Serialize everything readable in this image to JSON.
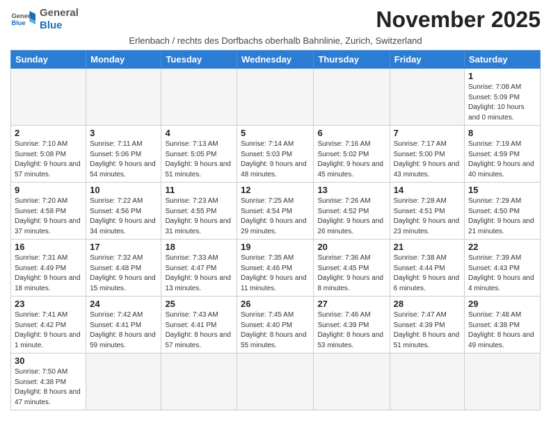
{
  "header": {
    "logo_general": "General",
    "logo_blue": "Blue",
    "month_title": "November 2025",
    "subtitle": "Erlenbach / rechts des Dorfbachs oberhalb Bahnlinie, Zurich, Switzerland"
  },
  "weekdays": [
    "Sunday",
    "Monday",
    "Tuesday",
    "Wednesday",
    "Thursday",
    "Friday",
    "Saturday"
  ],
  "weeks": [
    [
      {
        "day": "",
        "info": ""
      },
      {
        "day": "",
        "info": ""
      },
      {
        "day": "",
        "info": ""
      },
      {
        "day": "",
        "info": ""
      },
      {
        "day": "",
        "info": ""
      },
      {
        "day": "",
        "info": ""
      },
      {
        "day": "1",
        "info": "Sunrise: 7:08 AM\nSunset: 5:09 PM\nDaylight: 10 hours\nand 0 minutes."
      }
    ],
    [
      {
        "day": "2",
        "info": "Sunrise: 7:10 AM\nSunset: 5:08 PM\nDaylight: 9 hours\nand 57 minutes."
      },
      {
        "day": "3",
        "info": "Sunrise: 7:11 AM\nSunset: 5:06 PM\nDaylight: 9 hours\nand 54 minutes."
      },
      {
        "day": "4",
        "info": "Sunrise: 7:13 AM\nSunset: 5:05 PM\nDaylight: 9 hours\nand 51 minutes."
      },
      {
        "day": "5",
        "info": "Sunrise: 7:14 AM\nSunset: 5:03 PM\nDaylight: 9 hours\nand 48 minutes."
      },
      {
        "day": "6",
        "info": "Sunrise: 7:16 AM\nSunset: 5:02 PM\nDaylight: 9 hours\nand 45 minutes."
      },
      {
        "day": "7",
        "info": "Sunrise: 7:17 AM\nSunset: 5:00 PM\nDaylight: 9 hours\nand 43 minutes."
      },
      {
        "day": "8",
        "info": "Sunrise: 7:19 AM\nSunset: 4:59 PM\nDaylight: 9 hours\nand 40 minutes."
      }
    ],
    [
      {
        "day": "9",
        "info": "Sunrise: 7:20 AM\nSunset: 4:58 PM\nDaylight: 9 hours\nand 37 minutes."
      },
      {
        "day": "10",
        "info": "Sunrise: 7:22 AM\nSunset: 4:56 PM\nDaylight: 9 hours\nand 34 minutes."
      },
      {
        "day": "11",
        "info": "Sunrise: 7:23 AM\nSunset: 4:55 PM\nDaylight: 9 hours\nand 31 minutes."
      },
      {
        "day": "12",
        "info": "Sunrise: 7:25 AM\nSunset: 4:54 PM\nDaylight: 9 hours\nand 29 minutes."
      },
      {
        "day": "13",
        "info": "Sunrise: 7:26 AM\nSunset: 4:52 PM\nDaylight: 9 hours\nand 26 minutes."
      },
      {
        "day": "14",
        "info": "Sunrise: 7:28 AM\nSunset: 4:51 PM\nDaylight: 9 hours\nand 23 minutes."
      },
      {
        "day": "15",
        "info": "Sunrise: 7:29 AM\nSunset: 4:50 PM\nDaylight: 9 hours\nand 21 minutes."
      }
    ],
    [
      {
        "day": "16",
        "info": "Sunrise: 7:31 AM\nSunset: 4:49 PM\nDaylight: 9 hours\nand 18 minutes."
      },
      {
        "day": "17",
        "info": "Sunrise: 7:32 AM\nSunset: 4:48 PM\nDaylight: 9 hours\nand 15 minutes."
      },
      {
        "day": "18",
        "info": "Sunrise: 7:33 AM\nSunset: 4:47 PM\nDaylight: 9 hours\nand 13 minutes."
      },
      {
        "day": "19",
        "info": "Sunrise: 7:35 AM\nSunset: 4:46 PM\nDaylight: 9 hours\nand 11 minutes."
      },
      {
        "day": "20",
        "info": "Sunrise: 7:36 AM\nSunset: 4:45 PM\nDaylight: 9 hours\nand 8 minutes."
      },
      {
        "day": "21",
        "info": "Sunrise: 7:38 AM\nSunset: 4:44 PM\nDaylight: 9 hours\nand 6 minutes."
      },
      {
        "day": "22",
        "info": "Sunrise: 7:39 AM\nSunset: 4:43 PM\nDaylight: 9 hours\nand 4 minutes."
      }
    ],
    [
      {
        "day": "23",
        "info": "Sunrise: 7:41 AM\nSunset: 4:42 PM\nDaylight: 9 hours\nand 1 minute."
      },
      {
        "day": "24",
        "info": "Sunrise: 7:42 AM\nSunset: 4:41 PM\nDaylight: 8 hours\nand 59 minutes."
      },
      {
        "day": "25",
        "info": "Sunrise: 7:43 AM\nSunset: 4:41 PM\nDaylight: 8 hours\nand 57 minutes."
      },
      {
        "day": "26",
        "info": "Sunrise: 7:45 AM\nSunset: 4:40 PM\nDaylight: 8 hours\nand 55 minutes."
      },
      {
        "day": "27",
        "info": "Sunrise: 7:46 AM\nSunset: 4:39 PM\nDaylight: 8 hours\nand 53 minutes."
      },
      {
        "day": "28",
        "info": "Sunrise: 7:47 AM\nSunset: 4:39 PM\nDaylight: 8 hours\nand 51 minutes."
      },
      {
        "day": "29",
        "info": "Sunrise: 7:48 AM\nSunset: 4:38 PM\nDaylight: 8 hours\nand 49 minutes."
      }
    ],
    [
      {
        "day": "30",
        "info": "Sunrise: 7:50 AM\nSunset: 4:38 PM\nDaylight: 8 hours\nand 47 minutes."
      },
      {
        "day": "",
        "info": ""
      },
      {
        "day": "",
        "info": ""
      },
      {
        "day": "",
        "info": ""
      },
      {
        "day": "",
        "info": ""
      },
      {
        "day": "",
        "info": ""
      },
      {
        "day": "",
        "info": ""
      }
    ]
  ]
}
